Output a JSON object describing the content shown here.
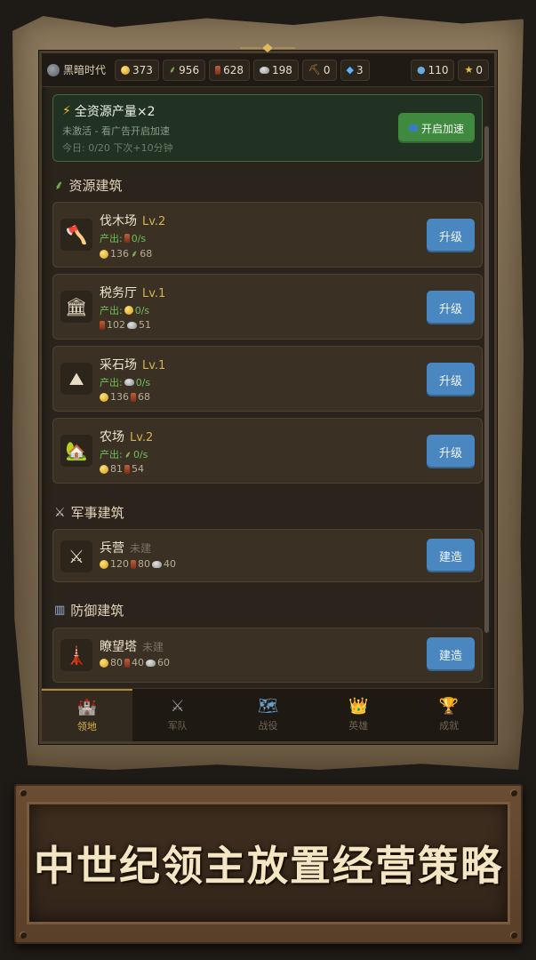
{
  "resource_bar": {
    "era_label": "黑暗时代",
    "gold": "373",
    "food": "956",
    "wood": "628",
    "stone": "198",
    "tools": "0",
    "gems": "3",
    "population": "110",
    "stars": "0"
  },
  "boost": {
    "title": "全资源产量×2",
    "status": "未激活 - 看广告开启加速",
    "today": "今日: 0/20   下次+10分钟",
    "button_label": "开启加速"
  },
  "sections": {
    "resource": "资源建筑",
    "military": "军事建筑",
    "defense": "防御建筑"
  },
  "common": {
    "output_label": "产出:",
    "upgrade_label": "升级",
    "build_label": "建造",
    "unbuilt_label": "未建"
  },
  "buildings": [
    {
      "name": "伐木场",
      "level": "Lv.2",
      "output": "0/s",
      "cost_a": "136",
      "cost_b": "68",
      "icon": "axe-icon"
    },
    {
      "name": "税务厅",
      "level": "Lv.1",
      "output": "0/s",
      "cost_a": "102",
      "cost_b": "51",
      "icon": "bank-icon"
    },
    {
      "name": "采石场",
      "level": "Lv.1",
      "output": "0/s",
      "cost_a": "136",
      "cost_b": "68",
      "icon": "mountain-icon"
    },
    {
      "name": "农场",
      "level": "Lv.2",
      "output": "0/s",
      "cost_a": "81",
      "cost_b": "54",
      "icon": "house-icon"
    },
    {
      "name": "兵营",
      "cost_a": "120",
      "cost_b": "80",
      "cost_c": "40",
      "icon": "crossed-swords-icon"
    },
    {
      "name": "瞭望塔",
      "cost_a": "80",
      "cost_b": "40",
      "cost_c": "60",
      "icon": "tower-icon"
    }
  ],
  "tabs": [
    {
      "label": "领地",
      "icon": "castle-icon"
    },
    {
      "label": "军队",
      "icon": "crossed-swords-icon"
    },
    {
      "label": "战役",
      "icon": "map-icon"
    },
    {
      "label": "英雄",
      "icon": "crown-icon"
    },
    {
      "label": "成就",
      "icon": "trophy-icon"
    }
  ],
  "banner": {
    "text": "中世纪领主放置经营策略"
  }
}
